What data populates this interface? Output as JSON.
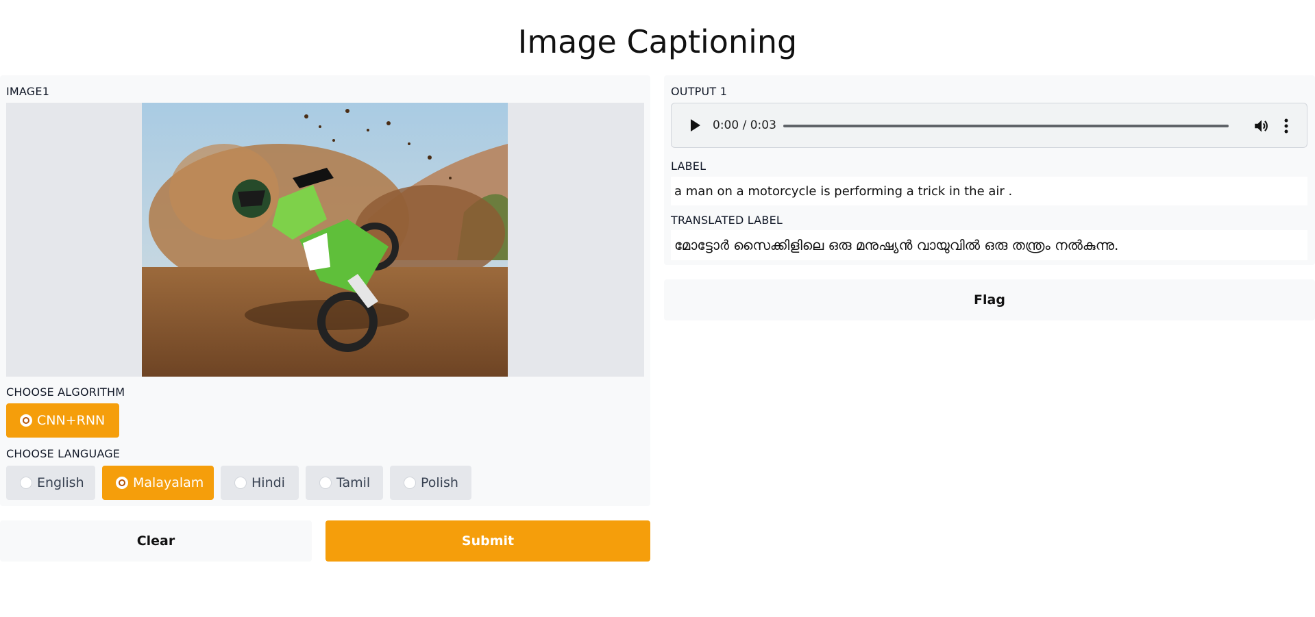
{
  "page": {
    "title": "Image Captioning"
  },
  "inputs": {
    "image_label": "IMAGE1",
    "algorithm_label": "CHOOSE ALGORITHM",
    "algorithms": [
      {
        "label": "CNN+RNN",
        "selected": true
      }
    ],
    "language_label": "CHOOSE LANGUAGE",
    "languages": [
      {
        "label": "English",
        "selected": false
      },
      {
        "label": "Malayalam",
        "selected": true
      },
      {
        "label": "Hindi",
        "selected": false
      },
      {
        "label": "Tamil",
        "selected": false
      },
      {
        "label": "Polish",
        "selected": false
      }
    ]
  },
  "actions": {
    "clear": "Clear",
    "submit": "Submit",
    "flag": "Flag"
  },
  "outputs": {
    "output_label": "OUTPUT 1",
    "audio": {
      "time": "0:00 / 0:03",
      "progress": 0
    },
    "label_label": "LABEL",
    "label_value": "a man on a motorcycle is performing a trick in the air .",
    "translated_label": "TRANSLATED LABEL",
    "translated_value": "മോട്ടോർ സൈക്കിളിലെ ഒരു മനുഷ്യൻ വായുവിൽ ഒരു തന്ത്രം നൽകുന്നു."
  },
  "colors": {
    "accent": "#f59e0b",
    "panel": "#f8f9fa",
    "neutral": "#e5e7eb"
  }
}
